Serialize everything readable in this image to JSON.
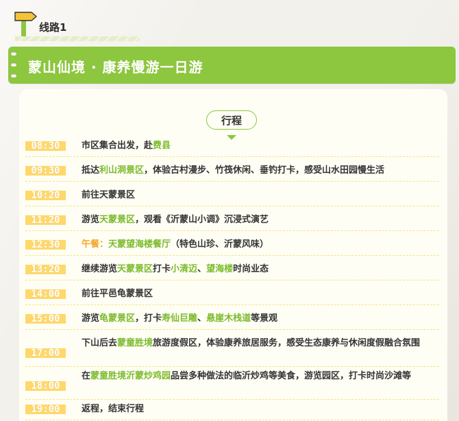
{
  "route": {
    "label": "线路1"
  },
  "banner": {
    "title": "蒙山仙境 · 康养慢游一日游"
  },
  "itinerary": {
    "section_label": "行程",
    "items": [
      {
        "time": "08:30",
        "parts": [
          {
            "t": "市区集合出发，赴"
          },
          {
            "t": "费县",
            "s": "hl"
          }
        ]
      },
      {
        "time": "09:30",
        "parts": [
          {
            "t": "抵达"
          },
          {
            "t": "利山洞景区",
            "s": "hl"
          },
          {
            "t": "，体验古村漫步、竹筏休闲、垂钓打卡，感受山水田园慢生活"
          }
        ]
      },
      {
        "time": "10:20",
        "parts": [
          {
            "t": "前往天蒙景区"
          }
        ]
      },
      {
        "time": "11:20",
        "parts": [
          {
            "t": "游览"
          },
          {
            "t": "天蒙景区",
            "s": "hl"
          },
          {
            "t": "，观看《沂蒙山小调》沉浸式演艺"
          }
        ]
      },
      {
        "time": "12:30",
        "parts": [
          {
            "t": "午餐：",
            "s": "orange"
          },
          {
            "t": "天蒙望海楼餐厅",
            "s": "hl"
          },
          {
            "t": "（特色山珍、沂蒙风味）"
          }
        ]
      },
      {
        "time": "13:20",
        "parts": [
          {
            "t": "继续游览"
          },
          {
            "t": "天蒙景区",
            "s": "hl"
          },
          {
            "t": "打卡"
          },
          {
            "t": "小清迈",
            "s": "hl"
          },
          {
            "t": "、"
          },
          {
            "t": "望海楼",
            "s": "hl"
          },
          {
            "t": "时尚业态"
          }
        ]
      },
      {
        "time": "14:00",
        "parts": [
          {
            "t": "前往平邑龟蒙景区"
          }
        ]
      },
      {
        "time": "15:00",
        "parts": [
          {
            "t": "游览"
          },
          {
            "t": "龟蒙景区",
            "s": "hl"
          },
          {
            "t": "，打卡"
          },
          {
            "t": "寿仙巨雕",
            "s": "hl"
          },
          {
            "t": "、"
          },
          {
            "t": "悬崖木栈道",
            "s": "hl"
          },
          {
            "t": "等景观"
          }
        ]
      },
      {
        "time": "17:00",
        "parts": [
          {
            "t": "下山后去"
          },
          {
            "t": "蒙童胜境",
            "s": "hl"
          },
          {
            "t": "旅游度假区，体验康养旅居服务，感受生态康养与休闲度假融合氛围"
          }
        ]
      },
      {
        "time": "18:00",
        "parts": [
          {
            "t": "在"
          },
          {
            "t": "蒙童胜境沂蒙炒鸡园",
            "s": "hl"
          },
          {
            "t": "品尝多种做法的临沂炒鸡等美食，游览园区，打卡时尚沙滩等"
          }
        ]
      },
      {
        "time": "19:00",
        "parts": [
          {
            "t": "返程，结束行程"
          }
        ]
      }
    ]
  },
  "colors": {
    "accent": "#8dc63f",
    "highlight": "#7cbb2c",
    "time_badge": "#ffd86b",
    "orange": "#f5a623"
  },
  "icons": {
    "signpost": "signpost-icon"
  }
}
